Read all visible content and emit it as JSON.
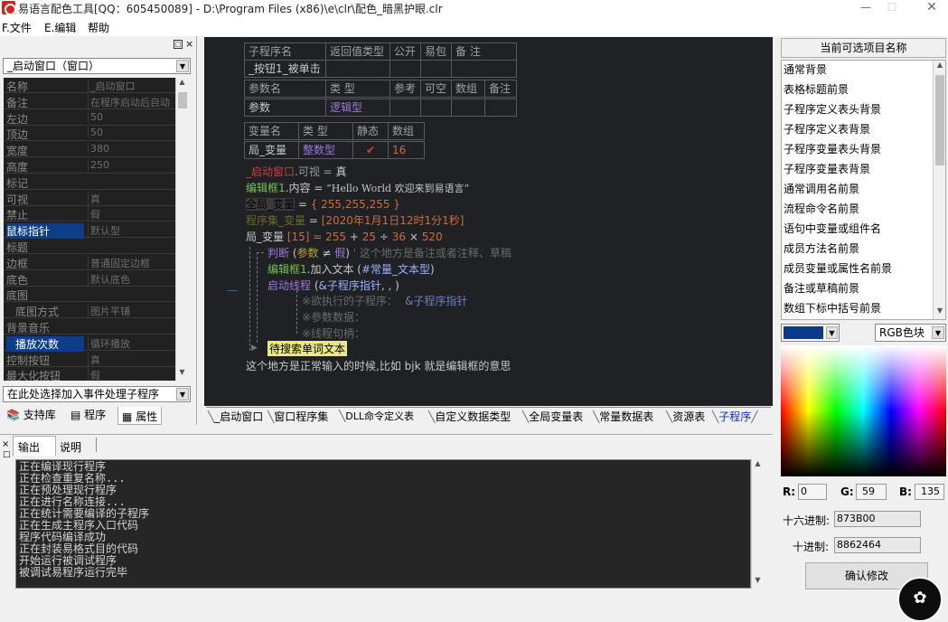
{
  "window": {
    "title": "易语言配色工具[QQ：605450089] - D:\\Program Files (x86)\\e\\clr\\配色_暗黑护眼.clr",
    "min": "—",
    "max": "☐",
    "close": "✕"
  },
  "menu": [
    "F.文件",
    "E.编辑",
    "帮助"
  ],
  "left": {
    "object_selector": "_启动窗口（窗口）",
    "properties": [
      {
        "name": "名称",
        "value": "_启动窗口"
      },
      {
        "name": "备注",
        "value": "在程序启动后自动"
      },
      {
        "name": "左边",
        "value": "50"
      },
      {
        "name": "顶边",
        "value": "50"
      },
      {
        "name": "宽度",
        "value": "380"
      },
      {
        "name": "高度",
        "value": "250"
      },
      {
        "name": "标记",
        "value": ""
      },
      {
        "name": "可视",
        "value": "真"
      },
      {
        "name": "禁止",
        "value": "假"
      },
      {
        "name": "鼠标指针",
        "value": "默认型"
      },
      {
        "name": "标题",
        "value": ""
      },
      {
        "name": "边框",
        "value": "普通固定边框"
      },
      {
        "name": "底色",
        "value": "默认底色"
      },
      {
        "name": "底图",
        "value": ""
      },
      {
        "name": "底图方式",
        "value": "图片平铺"
      },
      {
        "name": "背景音乐",
        "value": ""
      },
      {
        "name": "播放次数",
        "value": "循环播放"
      },
      {
        "name": "控制按钮",
        "value": "真"
      },
      {
        "name": "最大化按钮",
        "value": "假"
      }
    ],
    "event_selector": "在此处选择加入事件处理子程序",
    "tabs": [
      "支持库",
      "程序",
      "属性"
    ]
  },
  "code": {
    "sub_header": [
      "子程序名",
      "返回值类型",
      "公开",
      "易包",
      "备 注"
    ],
    "sub_name": "_按钮1_被单击",
    "param_header": [
      "参数名",
      "类 型",
      "参考",
      "可空",
      "数组",
      "备注"
    ],
    "param_row": {
      "name": "参数",
      "type": "逻辑型"
    },
    "var_header": [
      "变量名",
      "类 型",
      "静态",
      "数组"
    ],
    "var_row": {
      "name": "局_变量",
      "type": "整数型",
      "static": "✔",
      "array": "16"
    },
    "lines": {
      "l1a": "_启动窗口",
      "l1b": ".可视 = ",
      "l1c": "真",
      "l2a": "编辑框1",
      "l2b": ".内容 = ",
      "l2c": "“Hello World 欢迎来到易语言”",
      "l3a": "全局_变量",
      "l3b": " = ",
      "l3c": "{ 255,255,255 }",
      "l4a": "程序集_变量",
      "l4b": " = ",
      "l4c": "[2020年1月1日12时1分1秒]",
      "l5a": "局_变量",
      "l5b": " [15] = ",
      "l5c": "255",
      "l5d": " + ",
      "l5e": "25",
      "l5f": " ÷ ",
      "l5g": "36",
      "l5h": " × ",
      "l5i": "520",
      "l6a": "判断",
      "l6b": " (",
      "l6c": "参数",
      "l6d": " ≠ ",
      "l6e": "假",
      "l6f": ") ",
      "l6g": "' 这个地方是备注或者注释、草稿",
      "l7a": "编辑框1",
      "l7b": ".加入文本 (",
      "l7c": "#常量_文本型",
      "l7d": ")",
      "l8a": "启动线程",
      "l8b": " (",
      "l8c": "&子程序指针",
      "l8d": ", , )",
      "l9a": "※欲执行的子程序：",
      "l9b": "&子程序指针",
      "l10": "※参数数据：",
      "l11": "※线程句柄：",
      "l12": "待搜索单词文本",
      "l13": "这个地方是正常输入的时候,比如 bjk 就是编辑框的意思"
    },
    "tabs": [
      "_启动窗口",
      "窗口程序集",
      "DLL命令定义表",
      "自定义数据类型",
      "全局变量表",
      "常量数据表",
      "资源表",
      "子程序"
    ]
  },
  "output": {
    "tabs": [
      "输出",
      "说明"
    ],
    "lines": [
      "正在编译现行程序",
      "正在检查重复名称...",
      "正在预处理现行程序",
      "正在进行名称连接...",
      "正在统计需要编译的子程序",
      "正在生成主程序入口代码",
      "程序代码编译成功",
      "正在封装易格式目的代码",
      "开始运行被调试程序",
      "被调试易程序运行完毕"
    ]
  },
  "right": {
    "header": "当前可选项目名称",
    "items": [
      "通常背景",
      "表格标题前景",
      "子程序定义表头背景",
      "子程序定义表背景",
      "子程序变量表头背景",
      "子程序变量表背景",
      "通常调用名前景",
      "流程命令名前景",
      "语句中变量或组件名",
      "成员方法名前景",
      "成员变量或属性名前景",
      "备注或草稿前景",
      "数组下标中括号前景"
    ],
    "color_mode": "RGB色块",
    "swatch_color": "#0B3B87",
    "r_label": "R:",
    "r": "0",
    "g_label": "G:",
    "g": "59",
    "b_label": "B:",
    "b": "135",
    "hex_label": "十六进制:",
    "hex": "873B00",
    "dec_label": "十进制:",
    "dec": "8862464",
    "confirm": "确认修改"
  }
}
